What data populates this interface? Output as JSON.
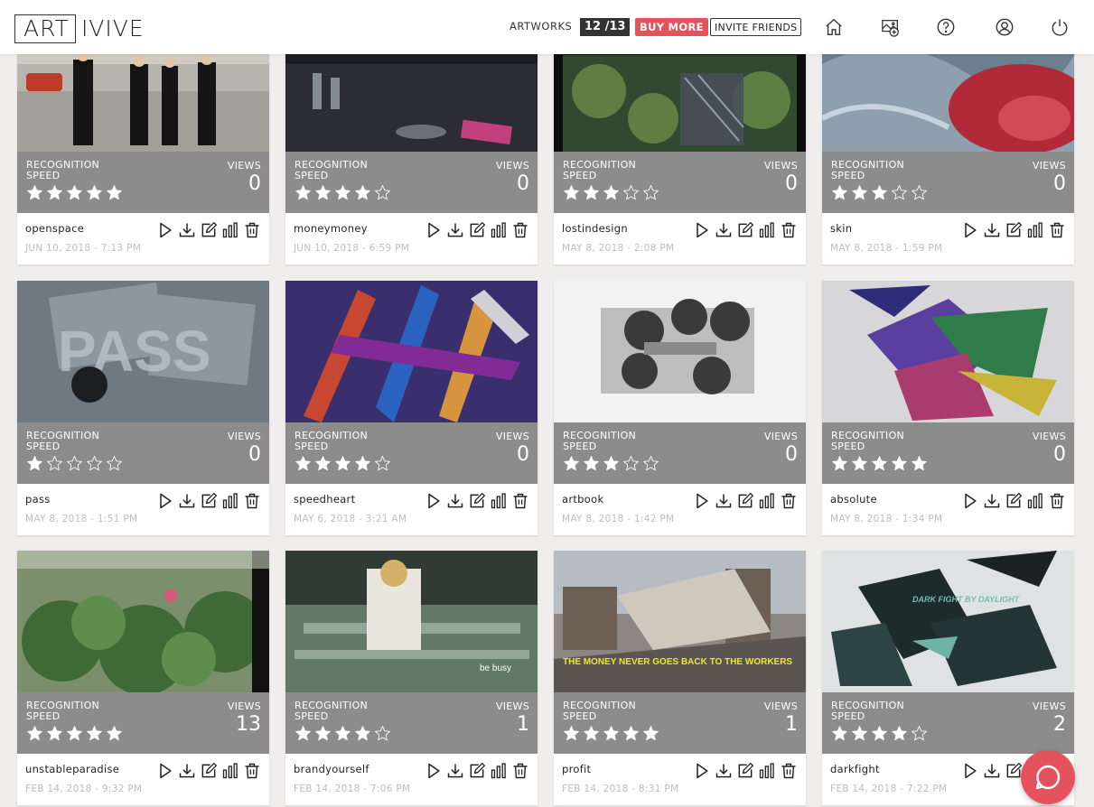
{
  "header": {
    "logo_boxed": "ART",
    "logo_rest": "IVIVE",
    "artworks_label": "ARTWORKS",
    "artworks_count": "12 /13",
    "buy_more": "BUY MORE",
    "invite_friends": "INVITE FRIENDS",
    "icons": [
      "home-icon",
      "add-artwork-icon",
      "help-icon",
      "account-icon",
      "power-icon"
    ]
  },
  "colors": {
    "accent": "#e4525e",
    "info_panel": "#8c8c8c",
    "badge": "#333333"
  },
  "card_labels": {
    "recognition": "RECOGNITION SPEED",
    "views": "VIEWS"
  },
  "artworks": [
    {
      "name": "openspace",
      "date": "JUN 10, 2018 - 7:13 PM",
      "views": "0",
      "rating": 5
    },
    {
      "name": "moneymoney",
      "date": "JUN 10, 2018 - 6:59 PM",
      "views": "0",
      "rating": 4
    },
    {
      "name": "lostindesign",
      "date": "MAY 8, 2018 - 2:08 PM",
      "views": "0",
      "rating": 3
    },
    {
      "name": "skin",
      "date": "MAY 8, 2018 - 1:59 PM",
      "views": "0",
      "rating": 3
    },
    {
      "name": "pass",
      "date": "MAY 8, 2018 - 1:51 PM",
      "views": "0",
      "rating": 1
    },
    {
      "name": "speedheart",
      "date": "MAY 6, 2018 - 3:21 AM",
      "views": "0",
      "rating": 4
    },
    {
      "name": "artbook",
      "date": "MAY 8, 2018 - 1:42 PM",
      "views": "0",
      "rating": 3
    },
    {
      "name": "absolute",
      "date": "MAY 8, 2018 - 1:34 PM",
      "views": "0",
      "rating": 5
    },
    {
      "name": "unstableparadise",
      "date": "FEB 14, 2018 - 9:32 PM",
      "views": "13",
      "rating": 5
    },
    {
      "name": "brandyourself",
      "date": "FEB 14, 2018 - 7:06 PM",
      "views": "1",
      "rating": 4
    },
    {
      "name": "profit",
      "date": "FEB 14, 2018 - 8:31 PM",
      "views": "1",
      "rating": 5
    },
    {
      "name": "darkfight",
      "date": "FEB 14, 2018 - 7:22 PM",
      "views": "2",
      "rating": 4
    }
  ],
  "thumbnail_captions": {
    "pass": "PASS",
    "brandyourself": "be busy",
    "profit": "THE MONEY NEVER GOES BACK TO THE WORKERS",
    "darkfight": "DARK FIGHT BY DAYLIGHT"
  },
  "card_actions": [
    "play-icon",
    "download-icon",
    "edit-icon",
    "stats-icon",
    "delete-icon"
  ],
  "chat_icon": "chat-icon"
}
